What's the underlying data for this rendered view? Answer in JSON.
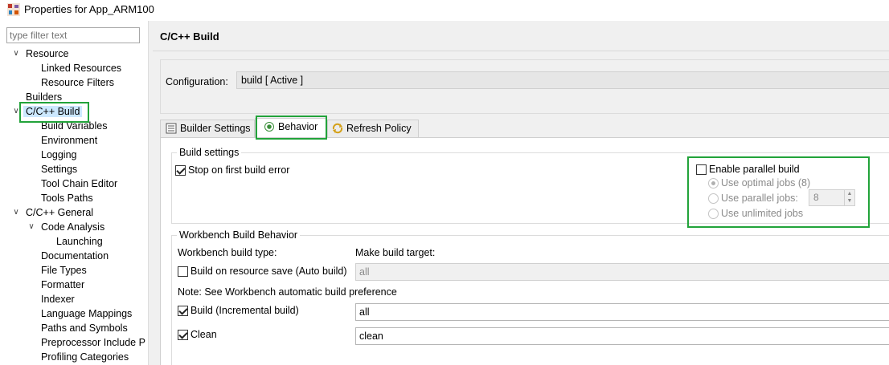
{
  "window": {
    "title": "Properties for App_ARM100",
    "icon": "app-properties-icon"
  },
  "filter": {
    "placeholder": "type filter text"
  },
  "tree": {
    "items": [
      {
        "label": "Resource",
        "expanded": true
      },
      {
        "label": "Linked Resources"
      },
      {
        "label": "Resource Filters"
      },
      {
        "label": "Builders"
      },
      {
        "label": "C/C++ Build",
        "expanded": true,
        "selected": true
      },
      {
        "label": "Build Variables"
      },
      {
        "label": "Environment"
      },
      {
        "label": "Logging"
      },
      {
        "label": "Settings"
      },
      {
        "label": "Tool Chain Editor"
      },
      {
        "label": "Tools Paths"
      },
      {
        "label": "C/C++ General",
        "expanded": true
      },
      {
        "label": "Code Analysis",
        "expanded": true
      },
      {
        "label": "Launching"
      },
      {
        "label": "Documentation"
      },
      {
        "label": "File Types"
      },
      {
        "label": "Formatter"
      },
      {
        "label": "Indexer"
      },
      {
        "label": "Language Mappings"
      },
      {
        "label": "Paths and Symbols"
      },
      {
        "label": "Preprocessor Include P"
      },
      {
        "label": "Profiling Categories"
      }
    ]
  },
  "page": {
    "title": "C/C++ Build"
  },
  "configuration": {
    "label": "Configuration:",
    "value": "build  [ Active ]"
  },
  "tabs": [
    {
      "label": "Builder Settings",
      "icon": "builder-settings-icon"
    },
    {
      "label": "Behavior",
      "icon": "radio-behavior-icon",
      "active": true
    },
    {
      "label": "Refresh Policy",
      "icon": "refresh-policy-icon"
    }
  ],
  "build_settings": {
    "title": "Build settings",
    "stop_on_first_error": {
      "label": "Stop on first build error",
      "checked": true
    },
    "enable_parallel": {
      "label": "Enable parallel build",
      "checked": false
    },
    "use_optimal_jobs": {
      "label": "Use optimal jobs (8)",
      "selected": true
    },
    "use_parallel_jobs": {
      "label": "Use parallel jobs:",
      "value": "8"
    },
    "use_unlimited_jobs": {
      "label": "Use unlimited jobs"
    }
  },
  "workbench": {
    "title": "Workbench Build Behavior",
    "build_type_label": "Workbench build type:",
    "make_target_label": "Make build target:",
    "auto_build": {
      "label": "Build on resource save (Auto build)",
      "checked": false,
      "target": "all"
    },
    "note": "Note: See Workbench automatic build preference",
    "incremental": {
      "label": "Build (Incremental build)",
      "checked": true,
      "target": "all"
    },
    "clean": {
      "label": "Clean",
      "checked": true,
      "target": "clean"
    }
  },
  "colors": {
    "highlight": "#22a33a",
    "selection": "#cce8ff"
  }
}
